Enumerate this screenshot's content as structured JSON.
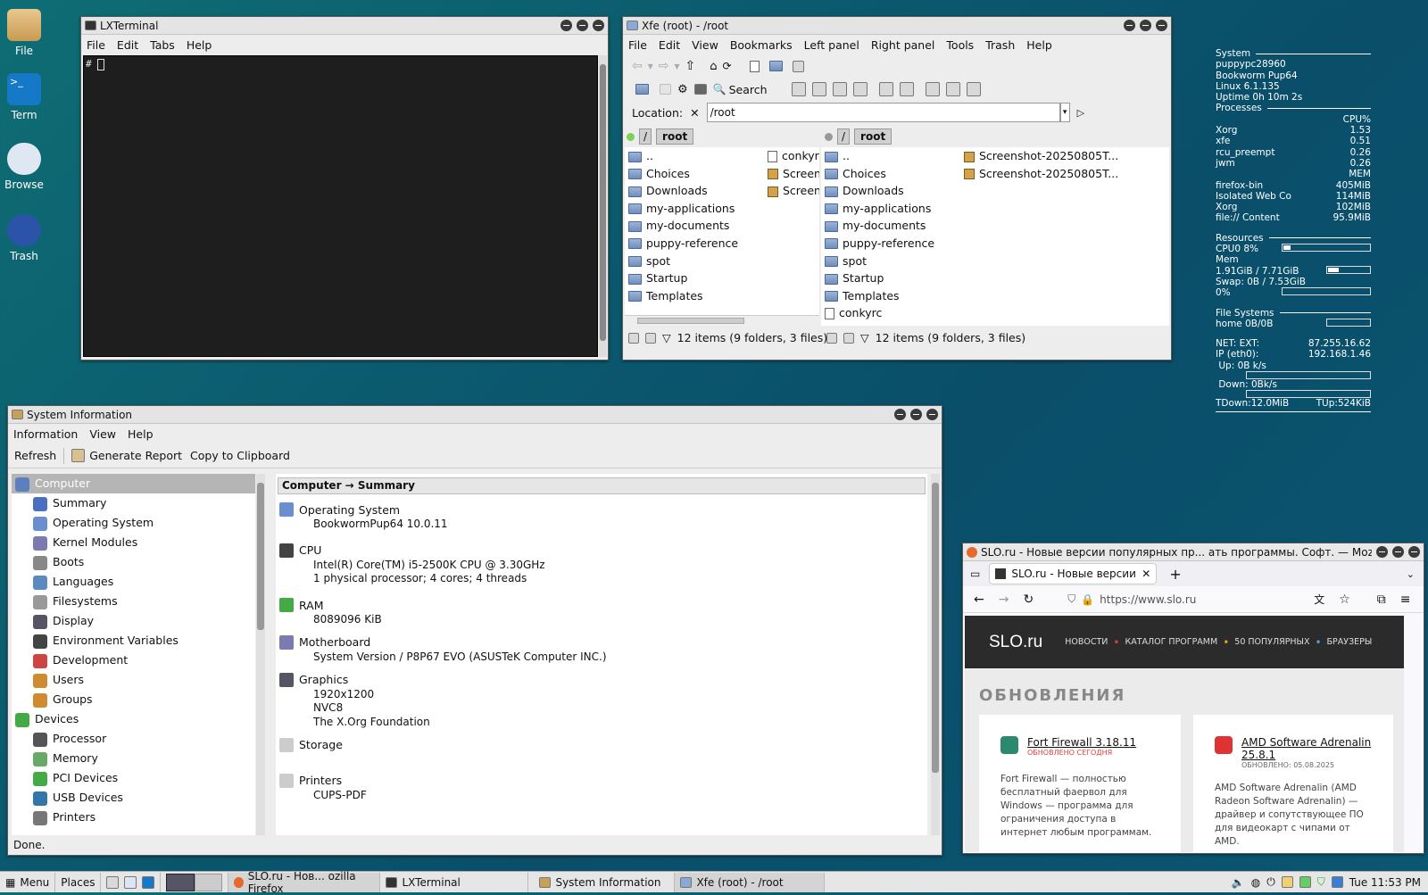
{
  "desktop": {
    "icons": [
      {
        "label": "File"
      },
      {
        "label": "Term"
      },
      {
        "label": "Browse"
      },
      {
        "label": "Trash"
      }
    ]
  },
  "terminal": {
    "title": "LXTerminal",
    "menu": [
      "File",
      "Edit",
      "Tabs",
      "Help"
    ],
    "prompt": "#"
  },
  "xfe": {
    "title": "Xfe (root) - /root",
    "menu": [
      "File",
      "Edit",
      "View",
      "Bookmarks",
      "Left panel",
      "Right panel",
      "Tools",
      "Trash",
      "Help"
    ],
    "search_label": "Search",
    "location_label": "Location:",
    "location_value": "/root",
    "left_breadcrumb": [
      "/",
      "root"
    ],
    "right_breadcrumb": [
      "/",
      "root"
    ],
    "left_files": [
      "..",
      "Choices",
      "Downloads",
      "my-applications",
      "my-documents",
      "puppy-reference",
      "spot",
      "Startup",
      "Templates"
    ],
    "left_files_col2": [
      "conkyrc",
      "Screens",
      "Screens"
    ],
    "right_files": [
      "..",
      "Choices",
      "Downloads",
      "my-applications",
      "my-documents",
      "puppy-reference",
      "spot",
      "Startup",
      "Templates",
      "conkyrc"
    ],
    "right_files_col2": [
      "Screenshot-20250805T...",
      "Screenshot-20250805T..."
    ],
    "left_status": "12 items (9 folders, 3 files)",
    "right_status": "12 items (9 folders, 3 files)"
  },
  "conky": {
    "system_hd": "System",
    "host": "puppypc28960",
    "distro": "Bookworm Pup64",
    "kernel": "Linux 6.1.135",
    "uptime": "Uptime 0h 10m 2s",
    "processes_hd": "Processes",
    "cpu_hd": "CPU%",
    "mem_hd": "MEM",
    "cpu_procs": [
      {
        "n": "Xorg",
        "v": "1.53"
      },
      {
        "n": "xfe",
        "v": "0.51"
      },
      {
        "n": "rcu_preempt",
        "v": "0.26"
      },
      {
        "n": "jwm",
        "v": "0.26"
      }
    ],
    "mem_procs": [
      {
        "n": "firefox-bin",
        "v": "405MiB"
      },
      {
        "n": "Isolated Web Co",
        "v": "114MiB"
      },
      {
        "n": "Xorg",
        "v": "102MiB"
      },
      {
        "n": "file:// Content",
        "v": "95.9MiB"
      }
    ],
    "resources_hd": "Resources",
    "cpu0": "CPU0 8%",
    "cpu0_frac": 0.08,
    "mem_label": "Mem",
    "mem_val": "1.91GiB / 7.71GiB",
    "mem_frac": 0.25,
    "swap": "Swap: 0B / 7.53GiB",
    "swap_pct": "0%",
    "swap_frac": 0,
    "fs_hd": "File Systems",
    "home": "home 0B/0B",
    "net_ext_label": "NET: EXT:",
    "net_ext": "87.255.16.62",
    "ip_label": "IP (eth0):",
    "ip": "192.168.1.46",
    "up": "Up: 0B k/s",
    "down": "Down: 0Bk/s",
    "tdown": "TDown:12.0MiB",
    "tup": "TUp:524KiB"
  },
  "sysinfo": {
    "title": "System Information",
    "menu": [
      "Information",
      "View",
      "Help"
    ],
    "toolbar": {
      "refresh": "Refresh",
      "report": "Generate Report",
      "copy": "Copy to Clipboard"
    },
    "tree": [
      {
        "l": "Computer",
        "lvl": 0,
        "sel": true
      },
      {
        "l": "Summary",
        "lvl": 1
      },
      {
        "l": "Operating System",
        "lvl": 1
      },
      {
        "l": "Kernel Modules",
        "lvl": 1
      },
      {
        "l": "Boots",
        "lvl": 1
      },
      {
        "l": "Languages",
        "lvl": 1
      },
      {
        "l": "Filesystems",
        "lvl": 1
      },
      {
        "l": "Display",
        "lvl": 1
      },
      {
        "l": "Environment Variables",
        "lvl": 1
      },
      {
        "l": "Development",
        "lvl": 1
      },
      {
        "l": "Users",
        "lvl": 1
      },
      {
        "l": "Groups",
        "lvl": 1
      },
      {
        "l": "Devices",
        "lvl": 0
      },
      {
        "l": "Processor",
        "lvl": 1
      },
      {
        "l": "Memory",
        "lvl": 1
      },
      {
        "l": "PCI Devices",
        "lvl": 1
      },
      {
        "l": "USB Devices",
        "lvl": 1
      },
      {
        "l": "Printers",
        "lvl": 1
      }
    ],
    "header": "Computer → Summary",
    "sections": [
      {
        "h": "Operating System",
        "v": [
          "BookwormPup64 10.0.11"
        ]
      },
      {
        "h": "CPU",
        "v": [
          "Intel(R) Core(TM) i5-2500K CPU @ 3.30GHz",
          "1 physical processor; 4 cores; 4 threads"
        ]
      },
      {
        "h": "RAM",
        "v": [
          "8089096 KiB"
        ]
      },
      {
        "h": "Motherboard",
        "v": [
          "System Version / P8P67 EVO (ASUSTeK Computer INC.)"
        ]
      },
      {
        "h": "Graphics",
        "v": [
          "1920x1200",
          "NVC8",
          "The X.Org Foundation"
        ]
      },
      {
        "h": "Storage",
        "v": []
      },
      {
        "h": "Printers",
        "v": [
          "CUPS-PDF"
        ]
      }
    ],
    "status": "Done."
  },
  "firefox": {
    "title": "SLO.ru - Новые версии популярных пр... ать программы. Софт. — Mozilla Firefox",
    "tab": "SLO.ru - Новые версии по",
    "url": "https://www.slo.ru",
    "site": {
      "logo": "SLO.ru",
      "nav": [
        "НОВОСТИ",
        "КАТАЛОГ ПРОГРАММ",
        "50 ПОПУЛЯРНЫХ",
        "БРАУЗЕРЫ"
      ],
      "heading": "ОБНОВЛЕНИЯ",
      "cards": [
        {
          "title": "Fort Firewall 3.18.11",
          "sub": "ОБНОВЛЕНО СЕГОДНЯ",
          "text": "Fort Firewall — полностью бесплатный фаервол для Windows — программа для ограничения доступа в интернет любым программам."
        },
        {
          "title": "AMD Software Adrenalin 25.8.1",
          "sub": "ОБНОВЛЕНО: 05.08.2025",
          "text": "AMD Software Adrenalin (AMD Radeon Software Adrenalin) — драйвер и сопутствующее ПО для видеокарт с чипами от AMD."
        }
      ]
    }
  },
  "taskbar": {
    "menu": "Menu",
    "places": "Places",
    "tasks": [
      "SLO.ru - Нов... ozilla Firefox",
      "LXTerminal",
      "System Information",
      "Xfe (root) - /root"
    ],
    "clock": "Tue 11:53 PM"
  },
  "colors": {
    "accent": "#e04040",
    "selection": "#b5b5b5"
  }
}
